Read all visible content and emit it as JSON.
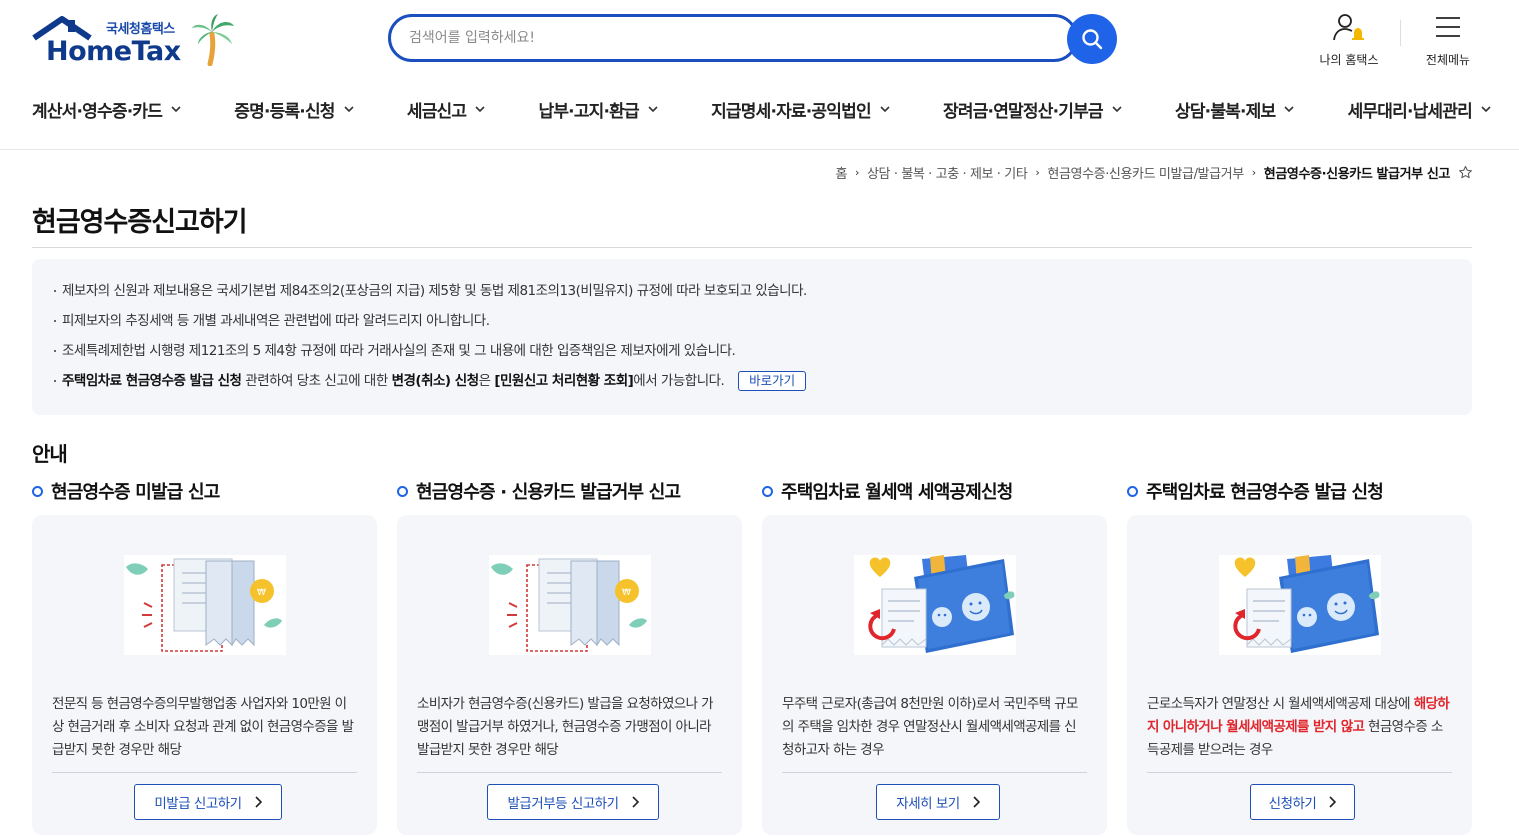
{
  "header": {
    "logo_small": "국세청홈택스",
    "logo_big": "HomeTax",
    "search_placeholder": "검색어를 입력하세요!",
    "my_hometax": "나의 홈택스",
    "full_menu": "전체메뉴"
  },
  "gnb": [
    "계산서·영수증·카드",
    "증명·등록·신청",
    "세금신고",
    "납부·고지·환급",
    "지급명세·자료·공익법인",
    "장려금·연말정산·기부금",
    "상담·불복·제보",
    "세무대리·납세관리"
  ],
  "breadcrumb": {
    "home": "홈",
    "level1": "상담 · 불복 · 고충 · 제보 · 기타",
    "level2": "현금영수증·신용카드 미발급/발급거부",
    "current": "현금영수증·신용카드 발급거부 신고"
  },
  "page_title": "현금영수증신고하기",
  "notice": {
    "line1": "제보자의 신원과 제보내용은 국세기본법 제84조의2(포상금의 지급) 제5항 및 동법 제81조의13(비밀유지) 규정에 따라 보호되고 있습니다.",
    "line2": "피제보자의 추징세액 등 개별 과세내역은 관련법에 따라 알려드리지 아니합니다.",
    "line3": "조세특례제한법 시행령 제121조의 5 제4항 규정에 따라 거래사실의 존재 및 그 내용에 대한 입증책임은 제보자에게 있습니다.",
    "line4_b1": "주택임차료 현금영수증 발급 신청",
    "line4_t1": " 관련하여 당초 신고에 대한 ",
    "line4_b2": "변경(취소) 신청",
    "line4_t2": "은 ",
    "line4_b3": "[민원신고 처리현황 조회]",
    "line4_t3": "에서 가능합니다.",
    "go_button": "바로가기"
  },
  "section_title": "안내",
  "cards": [
    {
      "heading": "현금영수증 미발급 신고",
      "desc": "전문직 등 현금영수증의무발행업종 사업자와 10만원 이상 현금거래 후 소비자 요청과 관계 없이 현금영수증을 발급받지 못한 경우만 해당",
      "button": "미발급 신고하기"
    },
    {
      "heading": "현금영수증 · 신용카드 발급거부 신고",
      "desc": "소비자가 현금영수증(신용카드) 발급을 요청하였으나 가맹점이 발급거부 하였거나, 현금영수증 가맹점이 아니라 발급받지 못한 경우만 해당",
      "button": "발급거부등 신고하기"
    },
    {
      "heading": "주택임차료 월세액 세액공제신청",
      "desc": "무주택 근로자(총급여 8천만원 이하)로서 국민주택 규모의 주택을 임차한 경우 연말정산시 월세액세액공제를 신청하고자 하는 경우",
      "button": "자세히 보기"
    },
    {
      "heading": "주택임차료 현금영수증 발급 신청",
      "desc_pre": "근로소득자가 연말정산 시 월세액세액공제 대상에 ",
      "desc_red": "해당하지 아니하거나 월세세액공제를 받지 않고",
      "desc_post": " 현금영수증 소득공제를 받으려는 경우",
      "button": "신청하기"
    }
  ],
  "colors": {
    "brand_blue": "#1f63e8",
    "logo_navy": "#0f3a8c",
    "button_border": "#1d4fb8",
    "highlight_red": "#e0262c"
  }
}
